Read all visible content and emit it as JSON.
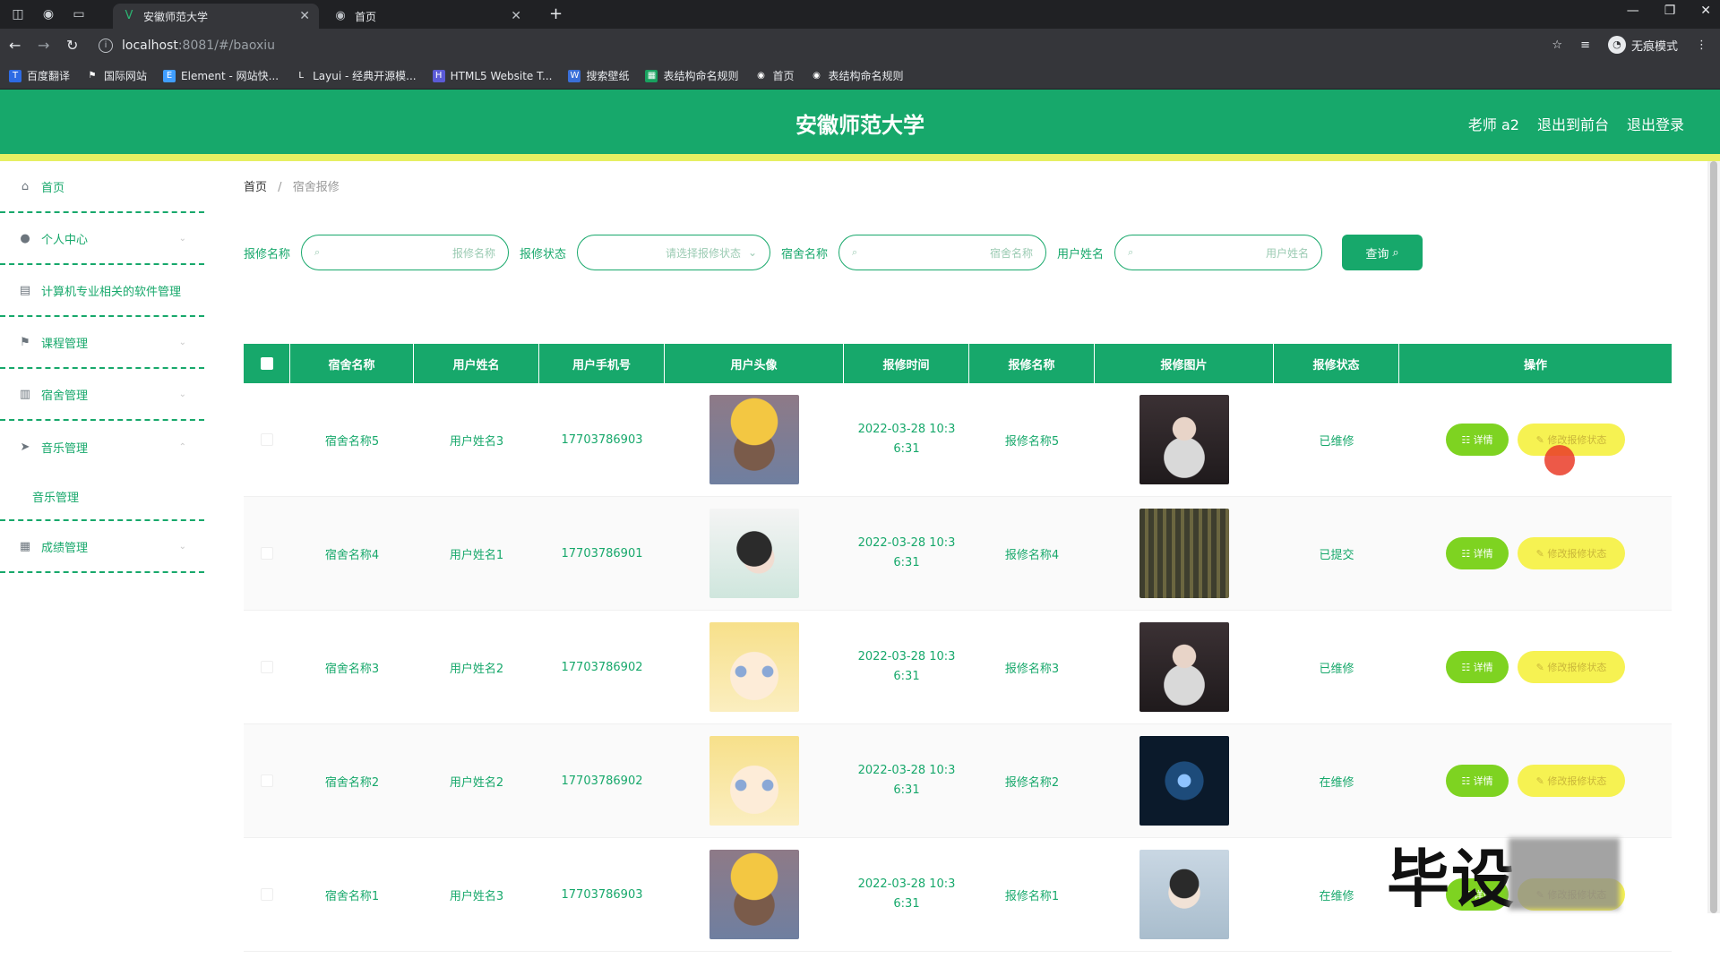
{
  "browser": {
    "tabs": [
      {
        "title": "安徽师范大学",
        "active": true
      },
      {
        "title": "首页",
        "active": false
      }
    ],
    "url_host": "localhost",
    "url_path": ":8081/#/baoxiu",
    "profile_label": "无痕模式",
    "bookmarks": [
      "百度翻译",
      "国际网站",
      "Element - 网站快...",
      "Layui - 经典开源模...",
      "HTML5 Website T...",
      "搜索壁纸",
      "表结构命名规则",
      "首页",
      "表结构命名规则"
    ]
  },
  "header": {
    "title": "安徽师范大学",
    "user": "老师 a2",
    "back_label": "退出到前台",
    "logout_label": "退出登录",
    "brand_color": "#17a86b",
    "accent_bar_color": "#e7ef63"
  },
  "sidebar": {
    "items": [
      {
        "label": "首页",
        "icon": "home-icon"
      },
      {
        "label": "个人中心",
        "icon": "user-icon"
      },
      {
        "label": "计算机专业相关的软件管理",
        "icon": "archive-icon"
      },
      {
        "label": "课程管理",
        "icon": "flag-icon"
      },
      {
        "label": "宿舍管理",
        "icon": "bar-chart-icon"
      },
      {
        "label": "音乐管理",
        "icon": "send-icon"
      },
      {
        "label": "成绩管理",
        "icon": "grid-icon"
      }
    ],
    "subitem": "音乐管理"
  },
  "breadcrumb": {
    "home": "首页",
    "current": "宿舍报修"
  },
  "search": {
    "fields": [
      {
        "label": "报修名称",
        "placeholder": "报修名称"
      },
      {
        "label": "报修状态",
        "placeholder": "请选择报修状态"
      },
      {
        "label": "宿舍名称",
        "placeholder": "宿舍名称"
      },
      {
        "label": "用户姓名",
        "placeholder": "用户姓名"
      }
    ],
    "button": "查询"
  },
  "table": {
    "headers": [
      "宿舍名称",
      "用户姓名",
      "用户手机号",
      "用户头像",
      "报修时间",
      "报修名称",
      "报修图片",
      "报修状态",
      "操作"
    ],
    "rows": [
      {
        "dorm": "宿舍名称5",
        "name": "用户姓名3",
        "phone": "17703786903",
        "time": "2022-03-28 10:3 6:31",
        "repair": "报修名称5",
        "status": "已维修",
        "avatar_style": "a",
        "photo_style": "a"
      },
      {
        "dorm": "宿舍名称4",
        "name": "用户姓名1",
        "phone": "17703786901",
        "time": "2022-03-28 10:3 6:31",
        "repair": "报修名称4",
        "status": "已提交",
        "avatar_style": "b",
        "photo_style": "b"
      },
      {
        "dorm": "宿舍名称3",
        "name": "用户姓名2",
        "phone": "17703786902",
        "time": "2022-03-28 10:3 6:31",
        "repair": "报修名称3",
        "status": "已维修",
        "avatar_style": "c",
        "photo_style": "a"
      },
      {
        "dorm": "宿舍名称2",
        "name": "用户姓名2",
        "phone": "17703786902",
        "time": "2022-03-28 10:3 6:31",
        "repair": "报修名称2",
        "status": "在维修",
        "avatar_style": "c",
        "photo_style": "c"
      },
      {
        "dorm": "宿舍名称1",
        "name": "用户姓名3",
        "phone": "17703786903",
        "time": "2022-03-28 10:3 6:31",
        "repair": "报修名称1",
        "status": "在维修",
        "avatar_style": "a",
        "photo_style": "d"
      }
    ],
    "action_details": "详情",
    "action_status": "修改报修状态"
  },
  "watermark_text": "毕设"
}
